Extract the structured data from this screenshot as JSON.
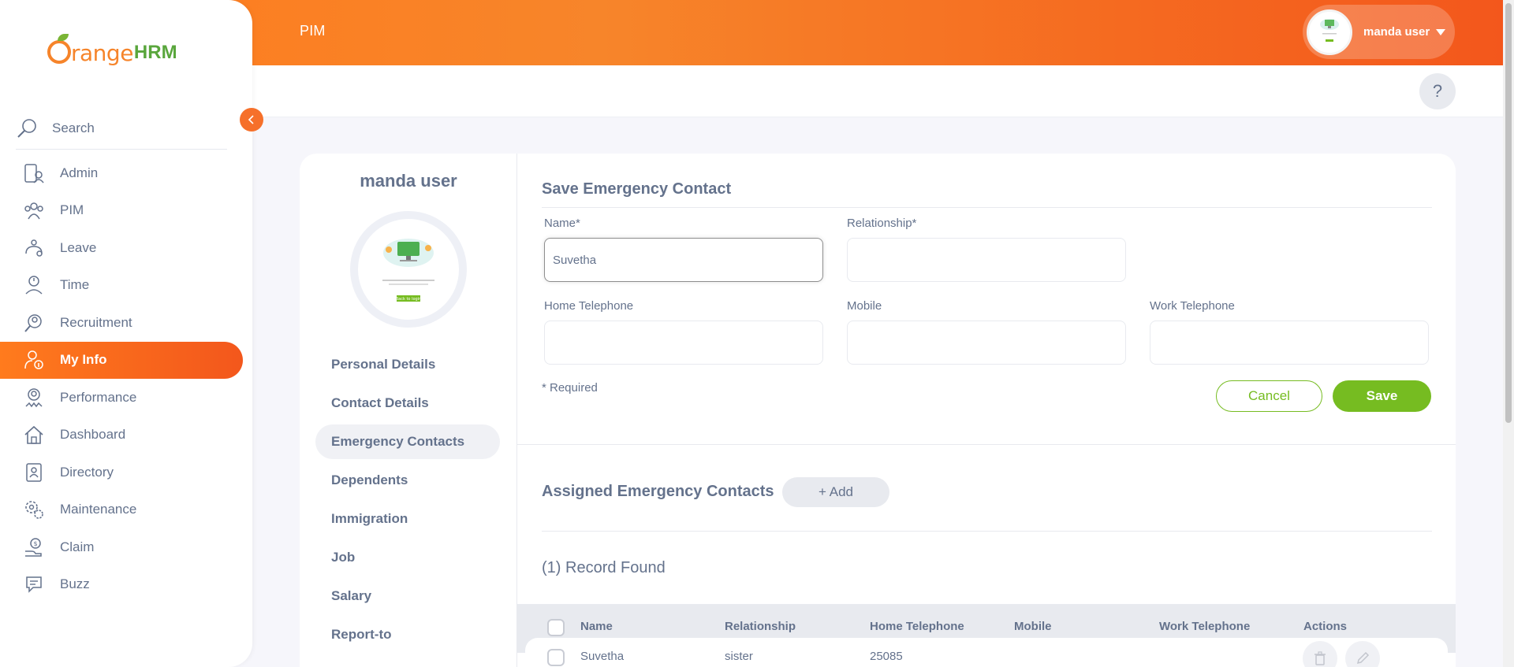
{
  "app": {
    "brand_word": "range",
    "brand_suffix": "HRM",
    "module_title": "PIM"
  },
  "user": {
    "name": "manda user"
  },
  "sidebar": {
    "search_label": "Search",
    "items": [
      {
        "label": "Admin",
        "icon": "admin-icon"
      },
      {
        "label": "PIM",
        "icon": "pim-icon"
      },
      {
        "label": "Leave",
        "icon": "leave-icon"
      },
      {
        "label": "Time",
        "icon": "time-icon"
      },
      {
        "label": "Recruitment",
        "icon": "recruitment-icon"
      },
      {
        "label": "My Info",
        "icon": "my-info-icon",
        "active": true
      },
      {
        "label": "Performance",
        "icon": "performance-icon"
      },
      {
        "label": "Dashboard",
        "icon": "dashboard-icon"
      },
      {
        "label": "Directory",
        "icon": "directory-icon"
      },
      {
        "label": "Maintenance",
        "icon": "maintenance-icon"
      },
      {
        "label": "Claim",
        "icon": "claim-icon"
      },
      {
        "label": "Buzz",
        "icon": "buzz-icon"
      }
    ]
  },
  "help": {
    "label": "?"
  },
  "employee": {
    "name": "manda user",
    "photo_caption": "Back to login",
    "tabs": [
      {
        "label": "Personal Details"
      },
      {
        "label": "Contact Details"
      },
      {
        "label": "Emergency Contacts",
        "active": true
      },
      {
        "label": "Dependents"
      },
      {
        "label": "Immigration"
      },
      {
        "label": "Job"
      },
      {
        "label": "Salary"
      },
      {
        "label": "Report-to"
      }
    ]
  },
  "form": {
    "title": "Save Emergency Contact",
    "name_label": "Name*",
    "name_value": "Suvetha",
    "relationship_label": "Relationship*",
    "relationship_value": "",
    "home_label": "Home Telephone",
    "home_value": "",
    "mobile_label": "Mobile",
    "mobile_value": "",
    "work_label": "Work Telephone",
    "work_value": "",
    "required_note": "* Required",
    "cancel_label": "Cancel",
    "save_label": "Save"
  },
  "assigned": {
    "title": "Assigned Emergency Contacts",
    "add_label": "+ Add",
    "records_found": "(1) Record Found",
    "columns": [
      "Name",
      "Relationship",
      "Home Telephone",
      "Mobile",
      "Work Telephone",
      "Actions"
    ],
    "rows": [
      {
        "name": "Suvetha",
        "relationship": "sister",
        "home": "25085",
        "mobile": "",
        "work": ""
      }
    ]
  },
  "colors": {
    "accent": "#f6702a",
    "green": "#76bc21",
    "text": "#64728c"
  }
}
